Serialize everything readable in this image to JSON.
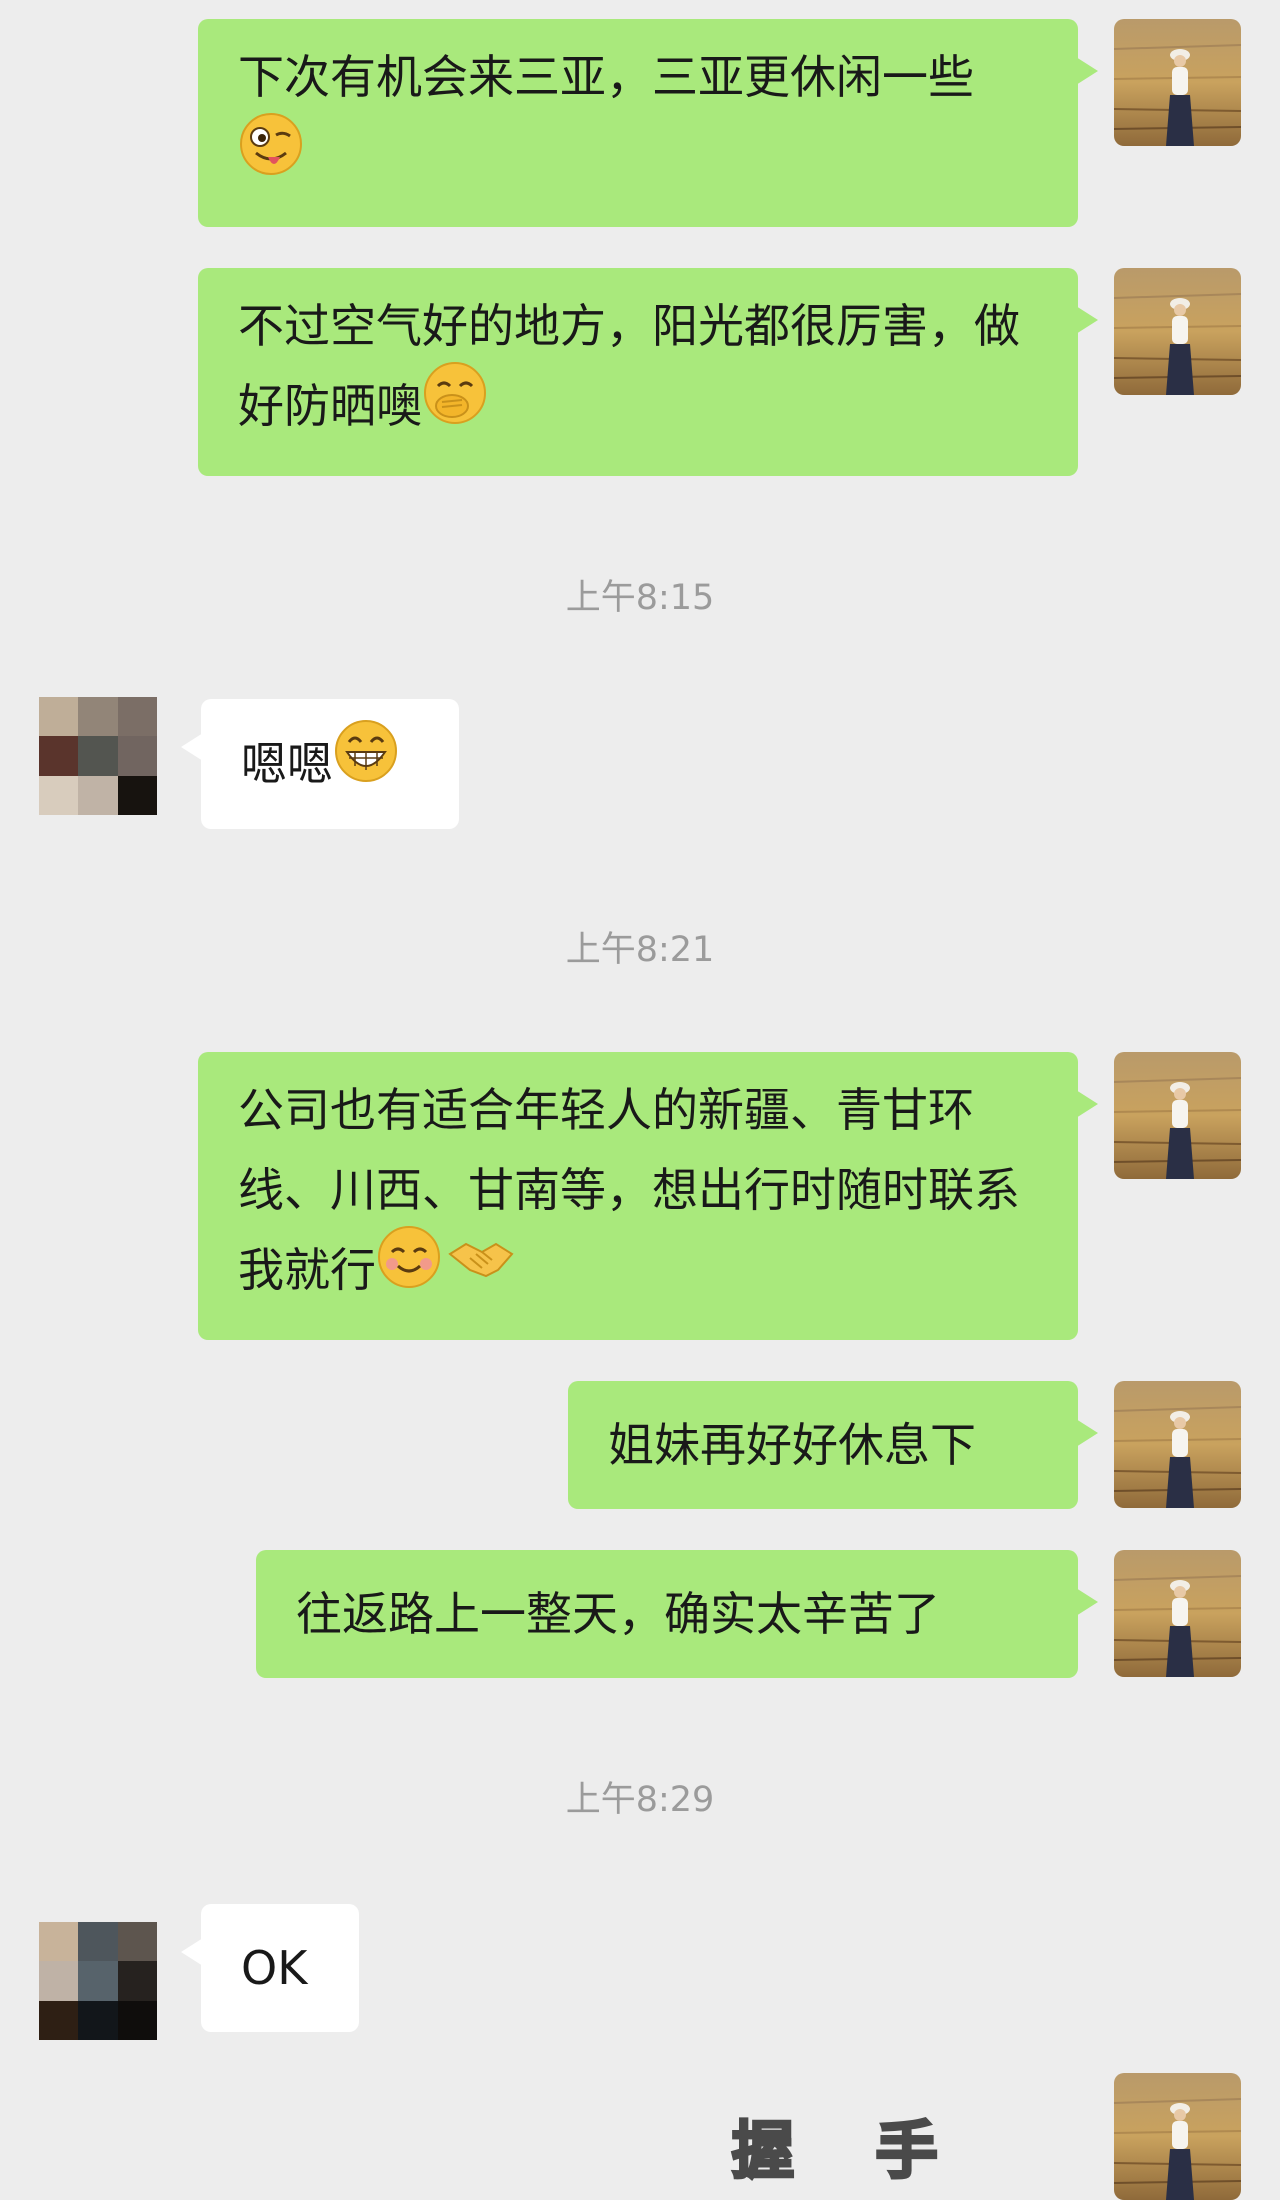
{
  "messages": {
    "m1": {
      "sender": "me",
      "text": "下次有机会来三亚，三亚更休闲一些",
      "emoji": "winking-tongue"
    },
    "m2": {
      "sender": "me",
      "text": "不过空气好的地方，阳光都很厉害，做好防晒噢",
      "emoji": "hand-over-mouth"
    },
    "t1": "上午8:15",
    "m3": {
      "sender": "other",
      "text": "嗯嗯",
      "emoji": "grinning"
    },
    "t2": "上午8:21",
    "m4": {
      "sender": "me",
      "text": "公司也有适合年轻人的新疆、青甘环线、川西、甘南等，想出行时随时联系我就行",
      "emoji": "smiling-handshake"
    },
    "m5": {
      "sender": "me",
      "text": "姐妹再好好休息下"
    },
    "m6": {
      "sender": "me",
      "text": "往返路上一整天，确实太辛苦了"
    },
    "t3": "上午8:29",
    "m7": {
      "sender": "other",
      "text": "OK"
    },
    "m8": {
      "sender": "me",
      "sticker_text": "握 手"
    }
  },
  "colors": {
    "background": "#ededed",
    "my_bubble": "#a9e97c",
    "other_bubble": "#ffffff",
    "timestamp": "#9b9b9b"
  }
}
